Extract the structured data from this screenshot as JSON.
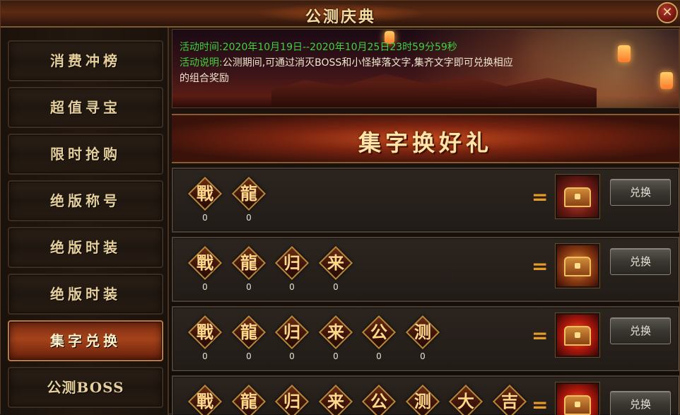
{
  "window": {
    "title": "公测庆典",
    "close_label": "✕"
  },
  "sidebar": {
    "items": [
      {
        "label": "消费冲榜"
      },
      {
        "label": "超值寻宝"
      },
      {
        "label": "限时抢购"
      },
      {
        "label": "绝版称号"
      },
      {
        "label": "绝版时装"
      },
      {
        "label": "绝版时装"
      },
      {
        "label": "集字兑换",
        "active": true
      },
      {
        "label": "公测BOSS"
      }
    ]
  },
  "banner": {
    "time_label": "活动时间:",
    "time_value": "2020年10月19日--2020年10月25日23时59分59秒",
    "desc_label": "活动说明:",
    "desc_value_line1": "公测期间,可通过消灭BOSS和小怪掉落文字,集齐文字即可兑换相应",
    "desc_value_line2": "的组合奖励"
  },
  "section": {
    "title": "集字换好礼"
  },
  "rows": [
    {
      "tokens": [
        {
          "char": "戰",
          "count": "0"
        },
        {
          "char": "龍",
          "count": "0"
        }
      ],
      "equals": "=",
      "reward_icon": "treasure-box-icon",
      "button": "兑换"
    },
    {
      "tokens": [
        {
          "char": "戰",
          "count": "0"
        },
        {
          "char": "龍",
          "count": "0"
        },
        {
          "char": "归",
          "count": "0"
        },
        {
          "char": "来",
          "count": "0"
        }
      ],
      "equals": "=",
      "reward_icon": "gold-chest-icon",
      "button": "兑换"
    },
    {
      "tokens": [
        {
          "char": "戰",
          "count": "0"
        },
        {
          "char": "龍",
          "count": "0"
        },
        {
          "char": "归",
          "count": "0"
        },
        {
          "char": "来",
          "count": "0"
        },
        {
          "char": "公",
          "count": "0"
        },
        {
          "char": "测",
          "count": "0"
        }
      ],
      "equals": "=",
      "reward_icon": "dragon-chest-icon",
      "button": "兑换"
    },
    {
      "tokens": [
        {
          "char": "戰"
        },
        {
          "char": "龍"
        },
        {
          "char": "归"
        },
        {
          "char": "来"
        },
        {
          "char": "公"
        },
        {
          "char": "测"
        },
        {
          "char": "大"
        },
        {
          "char": "吉"
        }
      ],
      "equals": "=",
      "reward_icon": "dragon-chest-icon",
      "button": "兑换"
    }
  ],
  "colors": {
    "info_label": "#3fd23f",
    "token_border": "#b8863a",
    "active_tab": "#a4431a"
  }
}
